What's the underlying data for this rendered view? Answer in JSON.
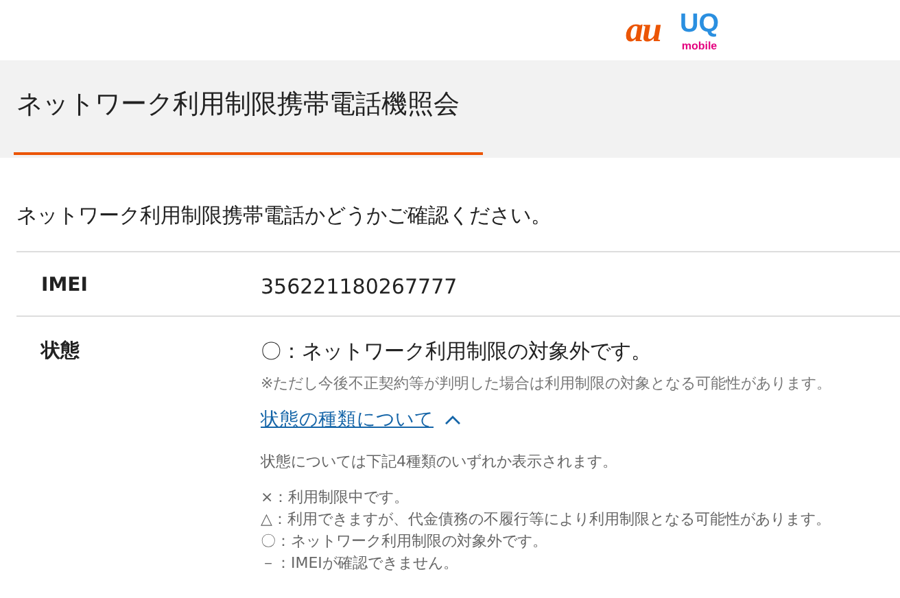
{
  "header": {
    "logos": [
      "au",
      "UQ",
      "mobile"
    ]
  },
  "page_title": "ネットワーク利用制限携帯電話機照会",
  "intro": "ネットワーク利用制限携帯電話かどうかご確認ください。",
  "rows": [
    {
      "label": "IMEI",
      "value": "356221180267777"
    },
    {
      "label": "状態",
      "value": "〇：ネットワーク利用制限の対象外です。",
      "note": "※ただし今後不正契約等が判明した場合は利用制限の対象となる可能性があります。",
      "toggle": {
        "label": "状態の種類について",
        "expanded": true
      },
      "details": {
        "lead": "状態については下記4種類のいずれか表示されます。",
        "items": [
          "×：利用制限中です。",
          "△：利用できますが、代金債務の不履行等により利用制限となる可能性があります。",
          "〇：ネットワーク利用制限の対象外です。",
          "－：IMEIが確認できません。"
        ]
      }
    }
  ]
}
